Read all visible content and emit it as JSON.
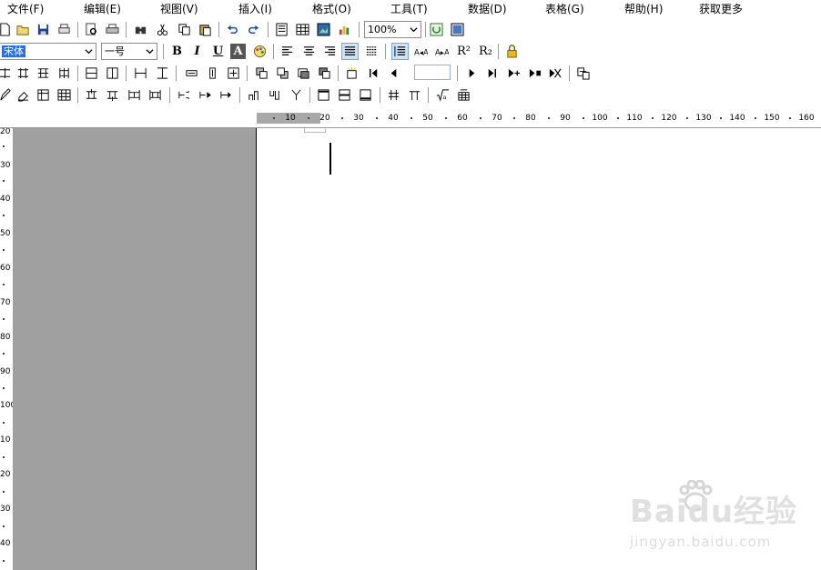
{
  "menu": {
    "items": [
      "文件(F)",
      "编辑(E)",
      "视图(V)",
      "插入(I)",
      "格式(O)",
      "工具(T)",
      "数据(D)",
      "表格(G)",
      "帮助(H)",
      "获取更多"
    ]
  },
  "toolbar1": {
    "zoom": "100%"
  },
  "toolbar2": {
    "font_name": "宋体",
    "font_size": "一号",
    "bold": "B",
    "italic": "I",
    "underline": "U",
    "outline": "A",
    "superscript": "R²",
    "subscript": "R₂"
  },
  "ruler": {
    "h_labels": [
      "10",
      "20",
      "30",
      "40",
      "50",
      "60",
      "70",
      "80",
      "90",
      "100",
      "110",
      "120",
      "130",
      "140",
      "150",
      "160"
    ],
    "v_labels": [
      "20",
      "30",
      "40",
      "50",
      "60",
      "70",
      "80",
      "90",
      "100",
      "10",
      "20",
      "30",
      "40"
    ]
  },
  "watermark": {
    "brand": "Baidu经验",
    "url": "jingyan.baidu.com"
  },
  "colors": {
    "selection": "#2a6fd6",
    "gray_margin": "#a0a0a0",
    "active_button": "#cfe3f7"
  },
  "icons": {
    "toolbar1": [
      "new-doc-icon",
      "open-folder-icon",
      "save-icon",
      "print-setup-icon",
      "print-preview-icon",
      "print-icon",
      "find-icon",
      "cut-icon",
      "copy-icon",
      "paste-icon",
      "undo-icon",
      "redo-icon",
      "page-layout-icon",
      "insert-table-icon",
      "insert-image-icon",
      "insert-chart-icon",
      "refresh-icon",
      "view-icon"
    ],
    "toolbar3": [
      "split-cells-icon",
      "merge-cells-icon",
      "insert-row-icon",
      "insert-col-icon",
      "cell-border-icon",
      "cell-fill-icon",
      "equal-width-icon",
      "equal-height-icon",
      "distribute-h-icon",
      "distribute-v-icon",
      "fit-icon",
      "bring-front-icon",
      "send-back-icon",
      "group-icon",
      "ungroup-icon",
      "new-record-icon",
      "first-record-icon",
      "prev-record-icon",
      "next-record-icon",
      "last-record-icon",
      "add-record-icon",
      "delete-record-icon",
      "stop-record-icon",
      "export-icon"
    ]
  }
}
